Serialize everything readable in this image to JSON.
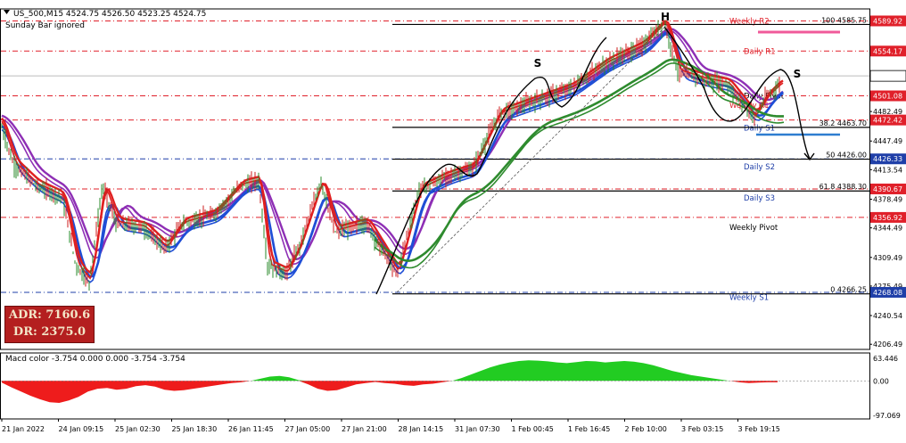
{
  "header": {
    "symbol_line": "US_500,M15  4524.75 4526.50 4523.25 4524.75",
    "sub_line": "Sunday Bar ignored",
    "arrow": "triangle-down-icon"
  },
  "adr_box": {
    "adr": "ADR: 7160.6",
    "dr": "DR: 2375.0"
  },
  "chart_data": {
    "type": "candlestick",
    "symbol": "US_500",
    "timeframe": "M15",
    "ohlc_last": [
      4524.75,
      4526.5,
      4523.25,
      4524.75
    ],
    "x_tick_labels": [
      "21 Jan 2022",
      "24 Jan 09:15",
      "25 Jan 02:30",
      "25 Jan 18:30",
      "26 Jan 11:45",
      "27 Jan 05:00",
      "27 Jan 21:00",
      "28 Jan 14:15",
      "31 Jan 07:30",
      "1 Feb 00:45",
      "1 Feb 16:45",
      "2 Feb 10:00",
      "3 Feb 03:15",
      "3 Feb 19:15"
    ],
    "y_tick_labels": [
      "4555.54",
      "4482.49",
      "4447.49",
      "4413.54",
      "4378.49",
      "4344.49",
      "4309.49",
      "4275.49",
      "4240.54",
      "4206.49"
    ],
    "price_tags": [
      {
        "value": "4589.92",
        "color": "#e0202a",
        "price": 4589.92
      },
      {
        "value": "4554.17",
        "color": "#e0202a",
        "price": 4554.17
      },
      {
        "value": "4524.75",
        "color": "#ffffff",
        "price": 4524.75
      },
      {
        "value": "4501.08",
        "color": "#e0202a",
        "price": 4501.08
      },
      {
        "value": "4472.42",
        "color": "#e0202a",
        "price": 4472.42
      },
      {
        "value": "4426.33",
        "color": "#1f3fa8",
        "price": 4426.33
      },
      {
        "value": "4390.67",
        "color": "#e0202a",
        "price": 4390.67
      },
      {
        "value": "4356.92",
        "color": "#e0202a",
        "price": 4356.92
      },
      {
        "value": "4268.08",
        "color": "#1f3fa8",
        "price": 4268.08
      }
    ],
    "pivot_levels": [
      {
        "name": "Weekly R2",
        "price": 4589.92,
        "color": "#e0202a"
      },
      {
        "name": "Daily R1",
        "price": 4554.17,
        "color": "#e0202a"
      },
      {
        "name": "Daily Pivot",
        "price": 4501.08,
        "color": "#000000"
      },
      {
        "name": "Weekly R1",
        "price": 4490,
        "color": "#e0202a"
      },
      {
        "name": "Daily S1",
        "price": 4463,
        "color": "#1f3fa8"
      },
      {
        "name": "Daily S2",
        "price": 4417,
        "color": "#1f3fa8"
      },
      {
        "name": "Daily S3",
        "price": 4380,
        "color": "#1f3fa8"
      },
      {
        "name": "Weekly Pivot",
        "price": 4345,
        "color": "#000000"
      },
      {
        "name": "Weekly S1",
        "price": 4262,
        "color": "#1f3fa8"
      }
    ],
    "fibonacci": [
      {
        "label": "100  4585.75",
        "price": 4585.75
      },
      {
        "label": "38.2  4463.70",
        "price": 4463.7
      },
      {
        "label": "50  4426.00",
        "price": 4426.0
      },
      {
        "label": "61.8  4388.30",
        "price": 4388.3
      },
      {
        "label": "0  4266.25",
        "price": 4266.25
      }
    ],
    "pattern_labels": [
      "S",
      "H",
      "S"
    ],
    "ylim": [
      4200,
      4600
    ],
    "macd": {
      "title": "Macd color -3.754 0.000 0.000 -3.754 -3.754",
      "y_tick_labels": [
        "63.446",
        "0.00",
        "-97.069"
      ],
      "ylim": [
        -97.069,
        63.446
      ],
      "values": [
        -5,
        -18,
        -30,
        -42,
        -52,
        -60,
        -62,
        -55,
        -45,
        -30,
        -22,
        -20,
        -25,
        -22,
        -15,
        -12,
        -16,
        -25,
        -28,
        -26,
        -22,
        -18,
        -14,
        -10,
        -6,
        -4,
        0,
        6,
        12,
        14,
        10,
        2,
        -10,
        -22,
        -28,
        -26,
        -18,
        -10,
        -6,
        -3,
        -6,
        -8,
        -12,
        -14,
        -10,
        -8,
        -4,
        0,
        8,
        18,
        28,
        38,
        46,
        52,
        56,
        58,
        57,
        55,
        52,
        50,
        53,
        56,
        55,
        52,
        54,
        56,
        54,
        50,
        44,
        36,
        28,
        22,
        16,
        12,
        8,
        4,
        0,
        -4,
        -6,
        -5,
        -4,
        -4
      ]
    }
  }
}
